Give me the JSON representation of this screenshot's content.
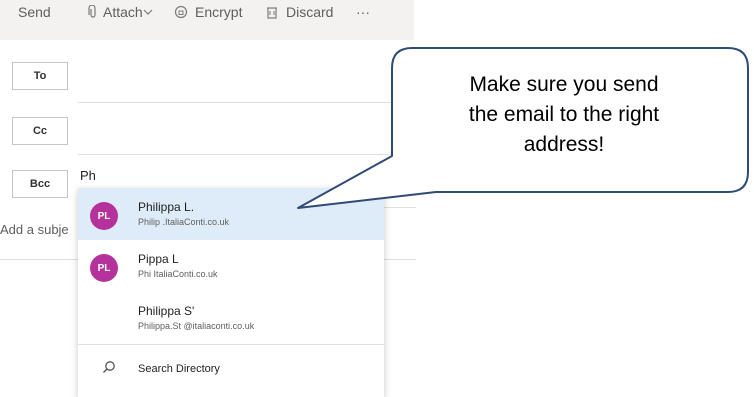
{
  "toolbar": {
    "send_label": "Send",
    "attach_label": "Attach",
    "encrypt_label": "Encrypt",
    "discard_label": "Discard",
    "more_label": "···"
  },
  "fields": {
    "to_label": "To",
    "cc_label": "Cc",
    "bcc_label": "Bcc",
    "typed_value": "Ph",
    "subject_placeholder": "Add a subje"
  },
  "suggestions": [
    {
      "initials": "PL",
      "name": "Philippa L.",
      "email": "Philip          .ItaliaConti.co.uk",
      "selected": true
    },
    {
      "initials": "PL",
      "name": "Pippa L",
      "email": "Phi                 ItaliaConti.co.uk",
      "selected": false
    },
    {
      "initials": "",
      "name": "Philippa S'",
      "email": "Philippa.St                         @italiaconti.co.uk",
      "selected": false
    }
  ],
  "search_directory_label": "Search Directory",
  "callout": {
    "line1": "Make sure you send",
    "line2": "the email to the right",
    "line3": "address!"
  },
  "colors": {
    "avatar": "#b5329d",
    "selected_row": "#deecf9",
    "callout_fill": "#ffffff",
    "callout_stroke": "#2f4a77"
  },
  "icons": {
    "attach": "paperclip-icon",
    "encrypt": "shield-lock-icon",
    "discard": "trash-icon",
    "search": "search-icon",
    "dropdown": "chevron-down-icon"
  }
}
